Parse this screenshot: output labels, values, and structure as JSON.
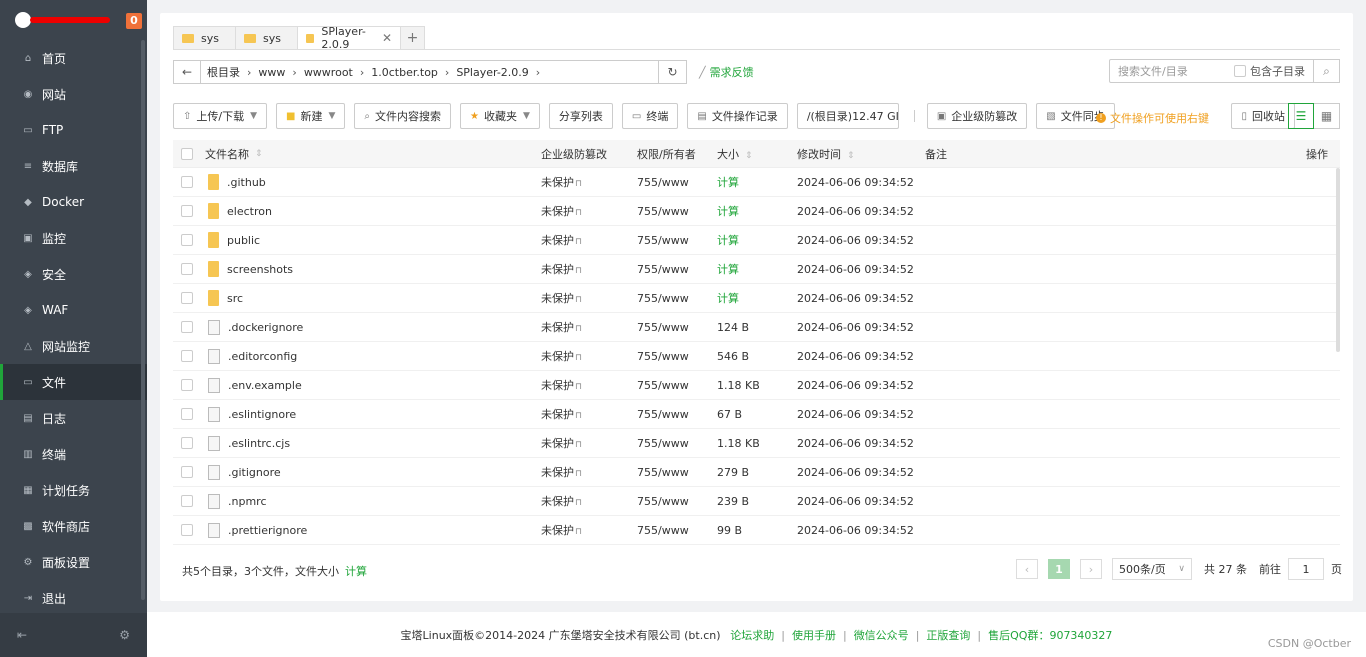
{
  "sidebar": {
    "badge": "0",
    "items": [
      {
        "label": "首页",
        "icon": "home-icon",
        "glyph": "⌂"
      },
      {
        "label": "网站",
        "icon": "globe-icon",
        "glyph": "◉"
      },
      {
        "label": "FTP",
        "icon": "ftp-icon",
        "glyph": "▭"
      },
      {
        "label": "数据库",
        "icon": "database-icon",
        "glyph": "≡"
      },
      {
        "label": "Docker",
        "icon": "docker-icon",
        "glyph": "◆"
      },
      {
        "label": "监控",
        "icon": "monitor-icon",
        "glyph": "▣"
      },
      {
        "label": "安全",
        "icon": "shield-icon",
        "glyph": "◈"
      },
      {
        "label": "WAF",
        "icon": "waf-icon",
        "glyph": "◈"
      },
      {
        "label": "网站监控",
        "icon": "chart-icon",
        "glyph": "△"
      },
      {
        "label": "文件",
        "icon": "folder-icon",
        "glyph": "▭"
      },
      {
        "label": "日志",
        "icon": "log-icon",
        "glyph": "▤"
      },
      {
        "label": "终端",
        "icon": "terminal-icon",
        "glyph": "▥"
      },
      {
        "label": "计划任务",
        "icon": "calendar-icon",
        "glyph": "▦"
      },
      {
        "label": "软件商店",
        "icon": "store-icon",
        "glyph": "▩"
      },
      {
        "label": "面板设置",
        "icon": "gear-icon",
        "glyph": "⚙"
      },
      {
        "label": "退出",
        "icon": "logout-icon",
        "glyph": "⇥"
      }
    ],
    "active_index": 9
  },
  "tabs": [
    {
      "label": "sys"
    },
    {
      "label": "sys"
    },
    {
      "label": "SPlayer-2.0.9"
    }
  ],
  "path": {
    "crumbs": [
      "根目录",
      "www",
      "wwwroot",
      "1.0ctber.top",
      "SPlayer-2.0.9"
    ],
    "feedback": "需求反馈"
  },
  "search": {
    "placeholder": "搜索文件/目录",
    "include_sub": "包含子目录"
  },
  "toolbar": {
    "upload": "上传/下载",
    "new": "新建",
    "content_search": "文件内容搜索",
    "favorites": "收藏夹",
    "share_list": "分享列表",
    "terminal": "终端",
    "op_log": "文件操作记录",
    "disk": "/(根目录)12.47 GI",
    "tamper": "企业级防篡改",
    "sync": "文件同步",
    "warn": "文件操作可使用右键",
    "recycle": "回收站"
  },
  "table": {
    "headers": {
      "name": "文件名称",
      "protect": "企业级防篡改",
      "perm": "权限/所有者",
      "size": "大小",
      "time": "修改时间",
      "note": "备注",
      "op": "操作"
    },
    "rows": [
      {
        "name": ".github",
        "type": "dir",
        "protect": "未保护",
        "perm": "755/www",
        "size": "计算",
        "time": "2024-06-06 09:34:52"
      },
      {
        "name": "electron",
        "type": "dir",
        "protect": "未保护",
        "perm": "755/www",
        "size": "计算",
        "time": "2024-06-06 09:34:52"
      },
      {
        "name": "public",
        "type": "dir",
        "protect": "未保护",
        "perm": "755/www",
        "size": "计算",
        "time": "2024-06-06 09:34:52"
      },
      {
        "name": "screenshots",
        "type": "dir",
        "protect": "未保护",
        "perm": "755/www",
        "size": "计算",
        "time": "2024-06-06 09:34:52"
      },
      {
        "name": "src",
        "type": "dir",
        "protect": "未保护",
        "perm": "755/www",
        "size": "计算",
        "time": "2024-06-06 09:34:52"
      },
      {
        "name": ".dockerignore",
        "type": "file",
        "protect": "未保护",
        "perm": "755/www",
        "size": "124 B",
        "time": "2024-06-06 09:34:52"
      },
      {
        "name": ".editorconfig",
        "type": "file",
        "protect": "未保护",
        "perm": "755/www",
        "size": "546 B",
        "time": "2024-06-06 09:34:52"
      },
      {
        "name": ".env.example",
        "type": "file",
        "protect": "未保护",
        "perm": "755/www",
        "size": "1.18 KB",
        "time": "2024-06-06 09:34:52"
      },
      {
        "name": ".eslintignore",
        "type": "file",
        "protect": "未保护",
        "perm": "755/www",
        "size": "67 B",
        "time": "2024-06-06 09:34:52"
      },
      {
        "name": ".eslintrc.cjs",
        "type": "file",
        "protect": "未保护",
        "perm": "755/www",
        "size": "1.18 KB",
        "time": "2024-06-06 09:34:52"
      },
      {
        "name": ".gitignore",
        "type": "file",
        "protect": "未保护",
        "perm": "755/www",
        "size": "279 B",
        "time": "2024-06-06 09:34:52"
      },
      {
        "name": ".npmrc",
        "type": "file",
        "protect": "未保护",
        "perm": "755/www",
        "size": "239 B",
        "time": "2024-06-06 09:34:52"
      },
      {
        "name": ".prettierignore",
        "type": "file",
        "protect": "未保护",
        "perm": "755/www",
        "size": "99 B",
        "time": "2024-06-06 09:34:52"
      }
    ]
  },
  "summary": {
    "text": "共5个目录，3个文件，文件大小",
    "calc": "计算"
  },
  "pager": {
    "current": "1",
    "per_page": "500条/页",
    "total": "共 27 条",
    "goto_label": "前往",
    "goto_value": "1",
    "page_unit": "页"
  },
  "footer": {
    "copyright": "宝塔Linux面板©2014-2024 广东堡塔安全技术有限公司 (bt.cn)",
    "links": [
      "论坛求助",
      "使用手册",
      "微信公众号",
      "正版查询",
      "售后QQ群：907340327"
    ]
  },
  "watermark": "CSDN @Octber",
  "colors": {
    "accent": "#20a53a",
    "warning": "#f0a020",
    "sidebar": "#3c444d"
  }
}
